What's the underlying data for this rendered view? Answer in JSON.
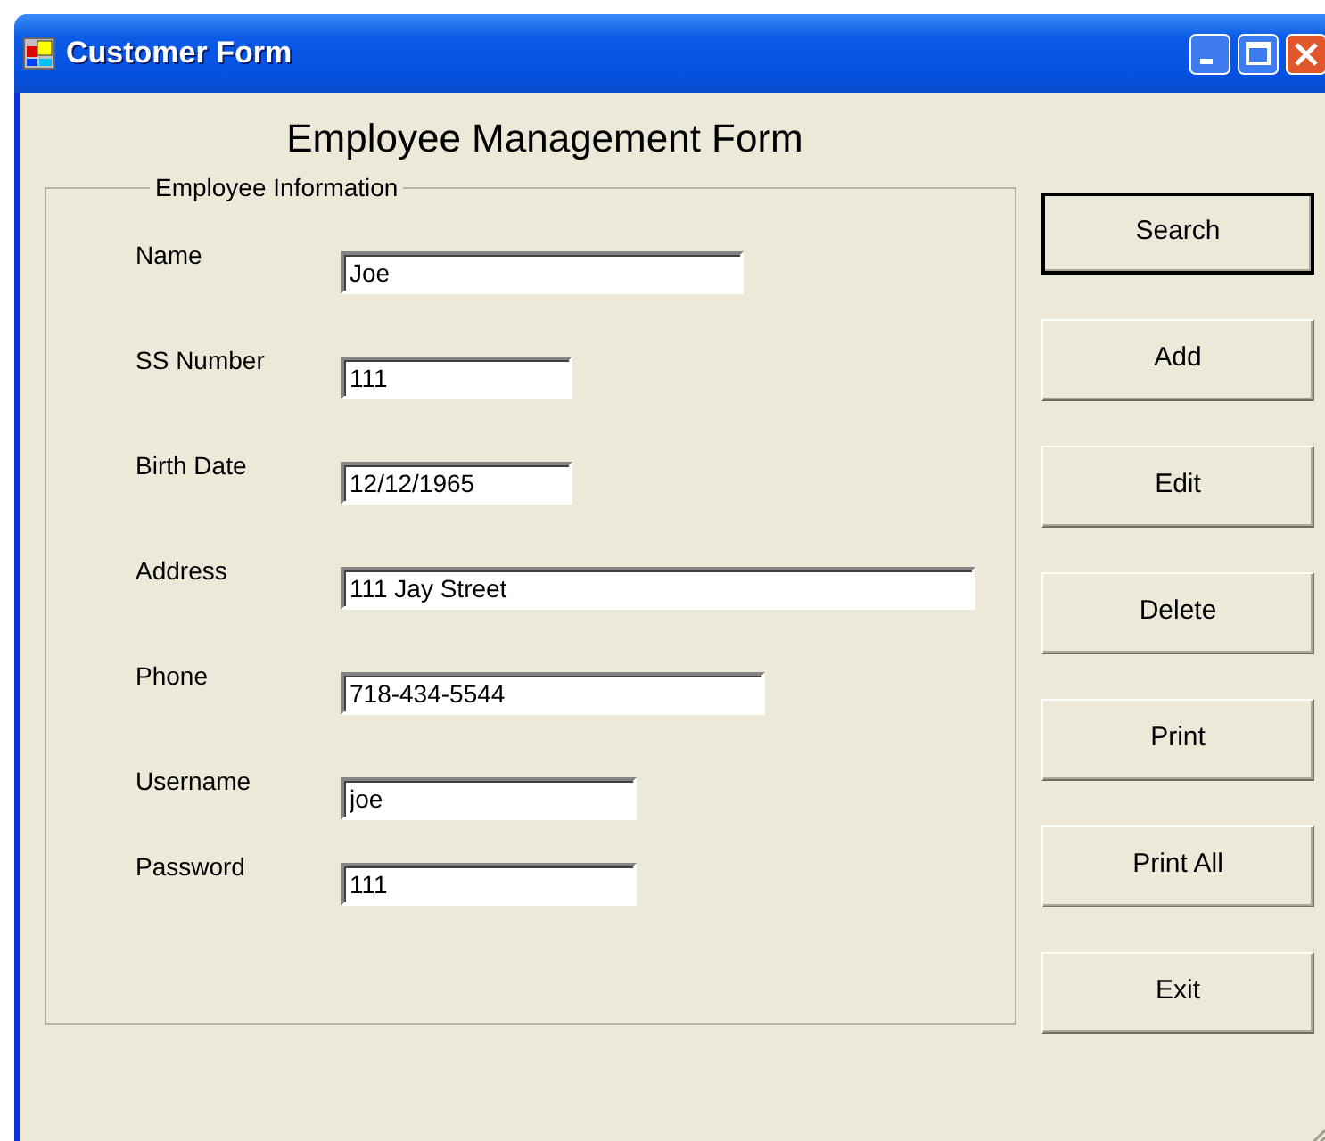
{
  "window": {
    "title": "Customer Form"
  },
  "heading": "Employee Management Form",
  "group": {
    "title": "Employee Information",
    "fields": [
      {
        "label": "Name",
        "value": "Joe"
      },
      {
        "label": "SS Number",
        "value": "111"
      },
      {
        "label": "Birth Date",
        "value": "12/12/1965"
      },
      {
        "label": "Address",
        "value": "111 Jay Street"
      },
      {
        "label": "Phone",
        "value": "718-434-5544"
      },
      {
        "label": "Username",
        "value": "joe"
      },
      {
        "label": "Password",
        "value": "111"
      }
    ]
  },
  "buttons": [
    {
      "label": "Search",
      "default": true
    },
    {
      "label": "Add",
      "default": false
    },
    {
      "label": "Edit",
      "default": false
    },
    {
      "label": "Delete",
      "default": false
    },
    {
      "label": "Print",
      "default": false
    },
    {
      "label": "Print All",
      "default": false
    },
    {
      "label": "Exit",
      "default": false
    }
  ]
}
